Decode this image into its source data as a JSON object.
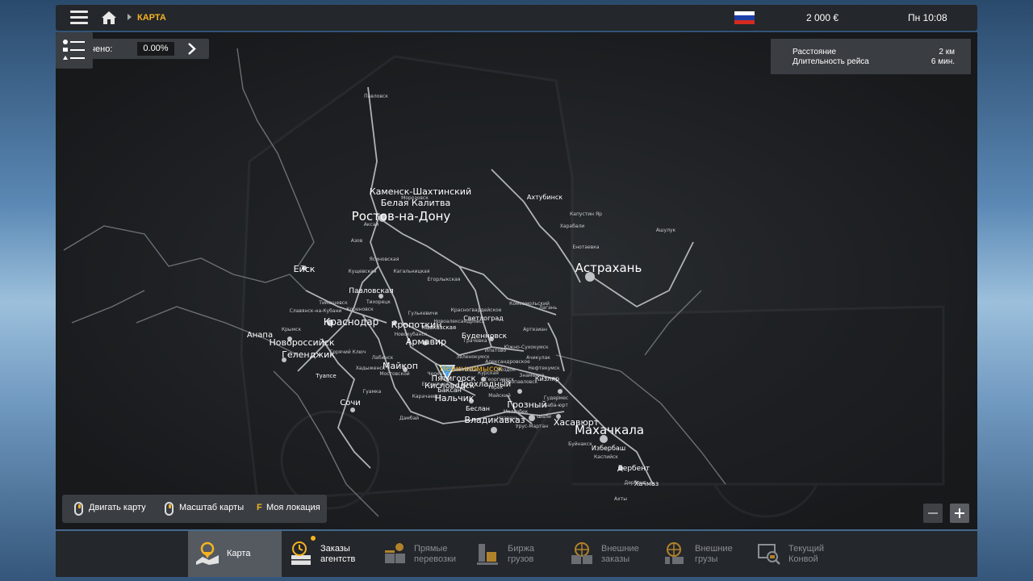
{
  "topbar": {
    "breadcrumb": "КАРТА",
    "money": "2 000 €",
    "clock": "Пн 10:08",
    "flag_colors": [
      "#ffffff",
      "#1c3faa",
      "#d52b1e"
    ]
  },
  "explored": {
    "label": "Изучено:",
    "value": "0.00%"
  },
  "route": {
    "distance_label": "Расстояние",
    "distance_value": "2 км",
    "duration_label": "Длительность рейса",
    "duration_value": "6 мин."
  },
  "map_controls": {
    "move": "Двигать карту",
    "zoom": "Масштаб карты",
    "location_key": "F",
    "location": "Моя локация"
  },
  "cities_major": [
    "Каменск-Шахтинский",
    "Белая Калитва",
    "Ростов-на-Дону",
    "Ахтубинск",
    "Астрахань",
    "Ейск",
    "Павловская",
    "Краснодар",
    "Кропоткин",
    "Анапа",
    "Новороссийск",
    "Геленджик",
    "Армавир",
    "Майкоп",
    "Невинномысск",
    "Пятигорск",
    "Кисловодск",
    "Прохладный",
    "Нальчик",
    "Грозный",
    "Владикавказ",
    "Кизляр",
    "Хасавюрт",
    "Махачкала",
    "Избербаш",
    "Дербент",
    "Хачмаз",
    "Сочи",
    "Буденновск",
    "Светлоград",
    "Беслан",
    "Баксан",
    "Туапсе",
    "Кавказская"
  ],
  "cities_minor": [
    "Павловск",
    "Морозовск",
    "Аксай",
    "Азов",
    "Ясиновская",
    "Кагальницкая",
    "Егорлыкская",
    "Кущевская",
    "Тимашевск",
    "Славянск-на-Кубани",
    "Кореновск",
    "Тихорецк",
    "Крымск",
    "Горячий Ключ",
    "Хадыженск",
    "Гулькевичи",
    "Красногвардейское",
    "Новоалександровск",
    "Зеленокумск",
    "Южно-Сухокумск",
    "Комсомольский",
    "Лагань",
    "Артезиан",
    "Харабали",
    "Капустин Яр",
    "Енотаевка",
    "Ашулук",
    "Ачикулак",
    "Нефтекумск",
    "Моздок",
    "Гудермес",
    "Каспийск",
    "Буйнакск",
    "Дербент",
    "Баба-юрт",
    "Дамбай",
    "Карачаевск",
    "Гуамка",
    "Курская",
    "Черкесск",
    "Ипатово",
    "Знаменка",
    "Мостовской",
    "Новокубанск",
    "Лабинск",
    "Грачевка",
    "Александровское",
    "Георгиевск",
    "Новопавловск",
    "Майский",
    "Ессентуки",
    "Минводы",
    "Терек",
    "Малгобек",
    "Назрань",
    "Шали",
    "Урус-Мартан",
    "Ахты"
  ],
  "tabs": [
    {
      "label": "Карта",
      "active": true
    },
    {
      "label": "Заказы агентств",
      "badge": true,
      "bright": true
    },
    {
      "label": "Прямые перевозки"
    },
    {
      "label": "Биржа грузов"
    },
    {
      "label": "Внешние заказы"
    },
    {
      "label": "Внешние грузы"
    },
    {
      "label": "Текущий Конвой"
    }
  ]
}
